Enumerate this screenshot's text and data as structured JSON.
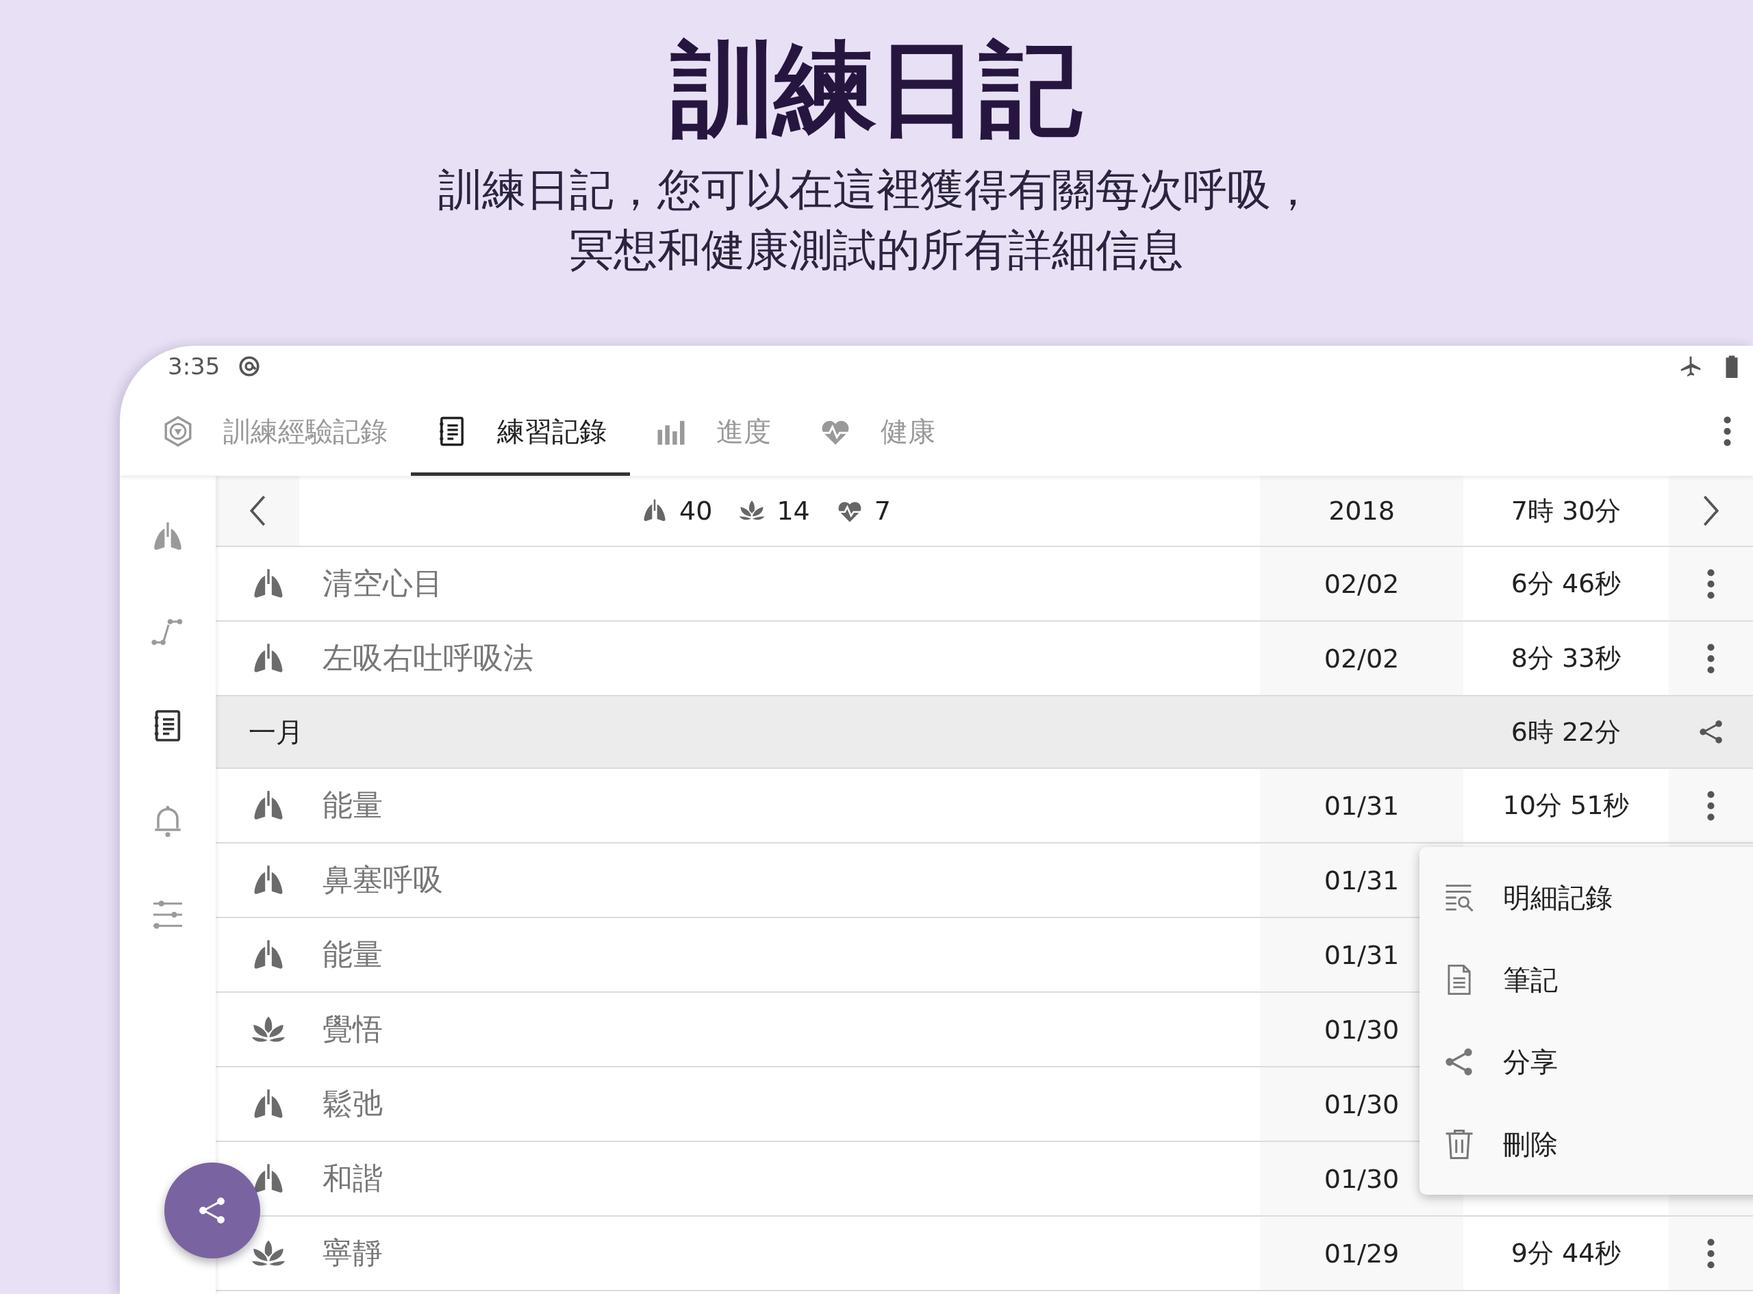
{
  "header": {
    "title": "訓練日記",
    "subtitle": [
      "訓練日記，您可以在這裡獲得有關每次呼吸，",
      "冥想和健康測試的所有詳細信息"
    ]
  },
  "status_bar": {
    "time": "3:35"
  },
  "tabs": [
    {
      "label": "訓練經驗記錄",
      "selected": false
    },
    {
      "label": "練習記錄",
      "selected": true
    },
    {
      "label": "進度",
      "selected": false
    },
    {
      "label": "健康",
      "selected": false
    }
  ],
  "sidebar": {
    "items": [
      {
        "selected": false
      },
      {
        "selected": false
      },
      {
        "selected": true
      },
      {
        "selected": false
      },
      {
        "selected": false
      }
    ]
  },
  "summary": {
    "counts": [
      "40",
      "14",
      "7"
    ],
    "year": "2018",
    "total": "7時 30分"
  },
  "rows": [
    {
      "kind": "breathing",
      "name": "清空心目",
      "date": "02/02",
      "duration": "6分 46秒",
      "menu": true
    },
    {
      "kind": "breathing",
      "name": "左吸右吐呼吸法",
      "date": "02/02",
      "duration": "8分 33秒",
      "menu": true
    },
    {
      "kind": "month",
      "name": "一月",
      "duration": "6時 22分",
      "share": true
    },
    {
      "kind": "breathing",
      "name": "能量",
      "date": "01/31",
      "duration": "10分 51秒",
      "menu": true
    },
    {
      "kind": "breathing",
      "name": "鼻塞呼吸",
      "date": "01/31",
      "menu": false
    },
    {
      "kind": "breathing",
      "name": "能量",
      "date": "01/31",
      "menu": false
    },
    {
      "kind": "meditation",
      "name": "覺悟",
      "date": "01/30",
      "menu": false
    },
    {
      "kind": "breathing",
      "name": "鬆弛",
      "date": "01/30",
      "menu": false
    },
    {
      "kind": "breathing",
      "name": "和諧",
      "date": "01/30",
      "menu": false
    },
    {
      "kind": "meditation",
      "name": "寧靜",
      "date": "01/29",
      "duration": "9分 44秒",
      "menu": true
    }
  ],
  "context_menu": {
    "items": [
      "明細記錄",
      "筆記",
      "分享",
      "刪除"
    ]
  }
}
